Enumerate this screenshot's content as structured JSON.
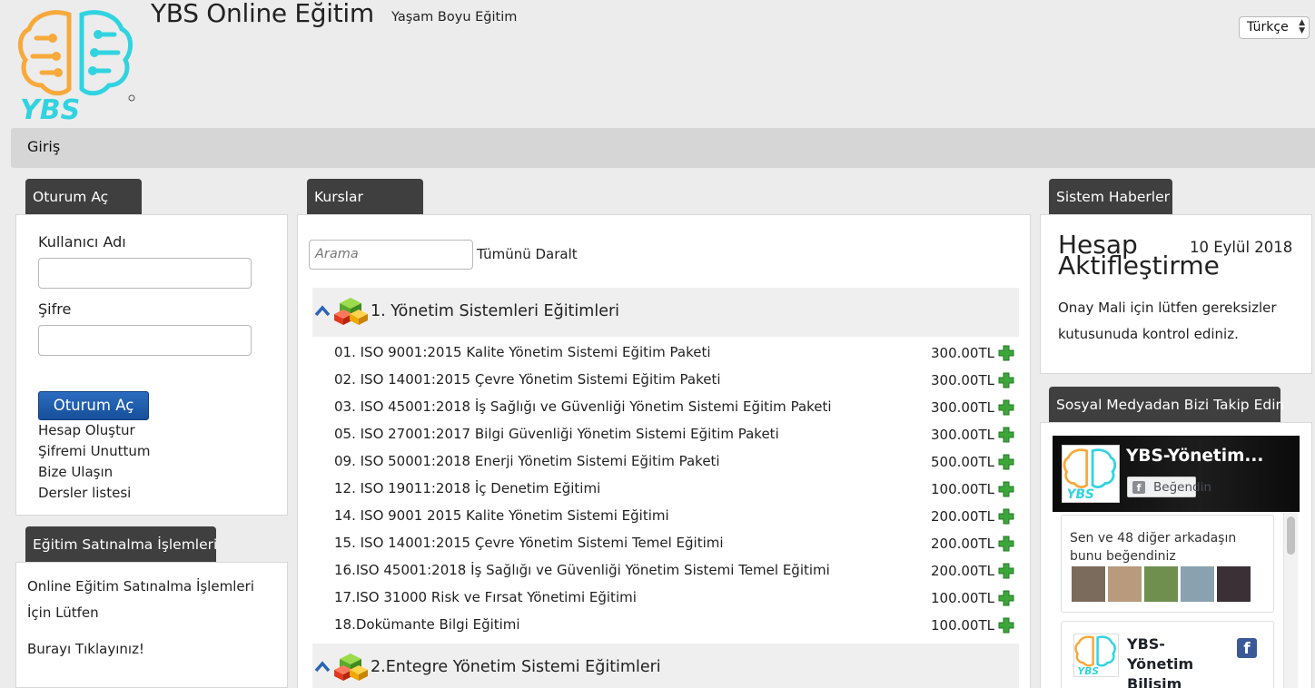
{
  "header": {
    "title": "YBS Online Eğitim",
    "subtitle": "Yaşam Boyu Eğitim",
    "language": "Türkçe"
  },
  "nav": {
    "items": [
      {
        "label": "Giriş"
      }
    ]
  },
  "login": {
    "header": "Oturum Aç",
    "username_label": "Kullanıcı Adı",
    "username_value": "",
    "password_label": "Şifre",
    "password_value": "",
    "submit_label": "Oturum Aç",
    "links": [
      "Hesap Oluştur",
      "Şifremi Unuttum",
      "Bize Ulaşın",
      "Dersler listesi"
    ]
  },
  "purchase": {
    "header": "Eğitim Satınalma İşlemleri",
    "text": "Online Eğitim Satınalma İşlemleri İçin Lütfen",
    "link": "Burayı Tıklayınız!"
  },
  "courses": {
    "header": "Kurslar",
    "search_placeholder": "Arama",
    "collapse_all": "Tümünü Daralt",
    "categories": [
      {
        "name": "1. Yönetim Sistemleri Eğitimleri",
        "items": [
          {
            "name": "01. ISO 9001:2015 Kalite Yönetim Sistemi Eğitim Paketi",
            "price": "300.00TL"
          },
          {
            "name": "02. ISO 14001:2015 Çevre Yönetim Sistemi Eğitim Paketi",
            "price": "300.00TL"
          },
          {
            "name": "03. ISO 45001:2018 İş Sağlığı ve Güvenliği Yönetim Sistemi Eğitim Paketi",
            "price": "300.00TL"
          },
          {
            "name": "05. ISO 27001:2017 Bilgi Güvenliği Yönetim Sistemi Eğitim Paketi",
            "price": "300.00TL"
          },
          {
            "name": "09. ISO 50001:2018 Enerji Yönetim Sistemi Eğitim Paketi",
            "price": "500.00TL"
          },
          {
            "name": "12. ISO 19011:2018 İç Denetim Eğitimi",
            "price": "100.00TL"
          },
          {
            "name": "14. ISO 9001 2015 Kalite Yönetim Sistemi Eğitimi",
            "price": "200.00TL"
          },
          {
            "name": "15. ISO 14001:2015 Çevre Yönetim Sistemi Temel Eğitimi",
            "price": "200.00TL"
          },
          {
            "name": "16.ISO 45001:2018 İş Sağlığı ve Güvenliği Yönetim Sistemi Temel Eğitimi",
            "price": "200.00TL"
          },
          {
            "name": "17.ISO 31000 Risk ve Fırsat Yönetimi Eğitimi",
            "price": "100.00TL"
          },
          {
            "name": "18.Dokümante Bilgi Eğitimi",
            "price": "100.00TL"
          }
        ]
      },
      {
        "name": "2.Entegre Yönetim Sistemi Eğitimleri",
        "items": []
      }
    ]
  },
  "news": {
    "header": "Sistem Haberler",
    "title": "Hesap Aktifleştirme",
    "date": "10 Eylül 2018",
    "body": "Onay Mali için lütfen gereksizler kutusunuda kontrol ediniz."
  },
  "social": {
    "header": "Sosyal Medyadan Bizi Takip Edin",
    "page_name": "YBS-Yönetim...",
    "like_label": "Beğendin",
    "friends_text": "Sen ve 48 diğer arkadaşın bunu beğendiniz",
    "card_name": "YBS-Yönetim Bilişim Sistemleri"
  },
  "colors": {
    "panel_header": "#3f3f3f",
    "button_blue": "#1f5eaf",
    "plus_green": "#3ca63a",
    "logo_orange": "#f7a93b",
    "logo_cyan": "#32d3e0"
  }
}
